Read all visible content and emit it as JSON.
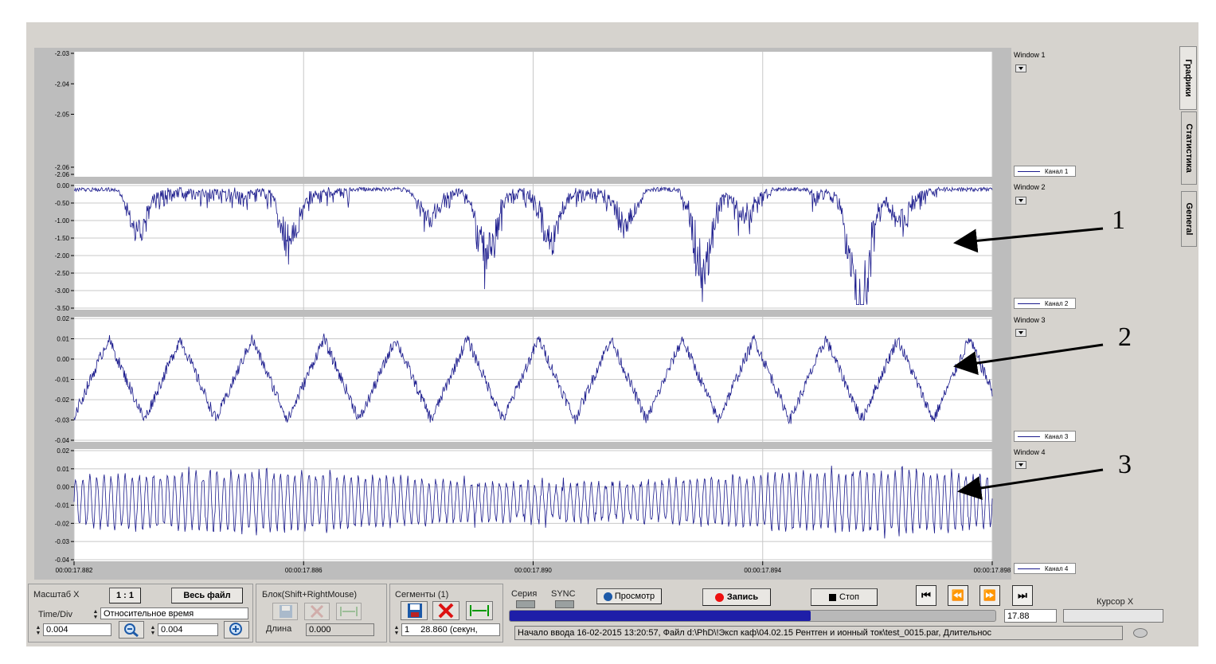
{
  "chart_data": [
    {
      "type": "line",
      "name_legend": "Канал 1",
      "window": "Window 1",
      "y_ticks": [
        "-2.03",
        "-2.04",
        "-2.05",
        "-2.06",
        "-2.06"
      ],
      "ylim": [
        -2.063,
        -2.029
      ]
    },
    {
      "type": "line",
      "name_legend": "Канал 2",
      "window": "Window 2",
      "y_ticks": [
        "0.00",
        "-0.50",
        "-1.00",
        "-1.50",
        "-2.00",
        "-2.50",
        "-3.00",
        "-3.50"
      ],
      "ylim": [
        -3.5,
        0.0
      ]
    },
    {
      "type": "line",
      "name_legend": "Канал 3",
      "window": "Window 3",
      "y_ticks": [
        "0.02",
        "0.01",
        "0.00",
        "-0.01",
        "-0.02",
        "-0.03",
        "-0.04"
      ],
      "ylim": [
        -0.04,
        0.02
      ]
    },
    {
      "type": "line",
      "name_legend": "Канал 4",
      "window": "Window 4",
      "y_ticks": [
        "0.02",
        "0.01",
        "0.00",
        "-0.01",
        "-0.02",
        "-0.03",
        "-0.04"
      ],
      "ylim": [
        -0.04,
        0.02
      ],
      "x_ticks": [
        "00:00:17.882",
        "00:00:17.886",
        "00:00:17.890",
        "00:00:17.894",
        "00:00:17.898"
      ]
    }
  ],
  "line_color": "#1a1a8c",
  "tabs": [
    "Графики",
    "Статистика",
    "General"
  ],
  "annotations": [
    "1",
    "2",
    "3"
  ],
  "scale": {
    "title": "Масштаб X",
    "ratio_btn": "1 : 1",
    "full_btn": "Весь файл",
    "time_div": "Time/Div",
    "mode": "Относительное время",
    "val1": "0.004",
    "val2": "0.004"
  },
  "block": {
    "title": "Блок(Shift+RightMouse)",
    "length_label": "Длина",
    "length_value": "0.000"
  },
  "segments": {
    "title": "Сегменты (1)",
    "index": "1",
    "duration": "28.860 (секун,"
  },
  "controls": {
    "series": "Серия",
    "sync": "SYNC",
    "view": "Просмотр",
    "record": "Запись",
    "stop": "Стоп",
    "cursor_label": "Курсор X",
    "cursor_value": "17.88"
  },
  "progress": 0.62,
  "status": "Начало ввода   16-02-2015 13:20:57, Файл d:\\PhD\\!Эксп каф\\04.02.15 Рентген и ионный ток\\test_0015.par, Длительнос"
}
